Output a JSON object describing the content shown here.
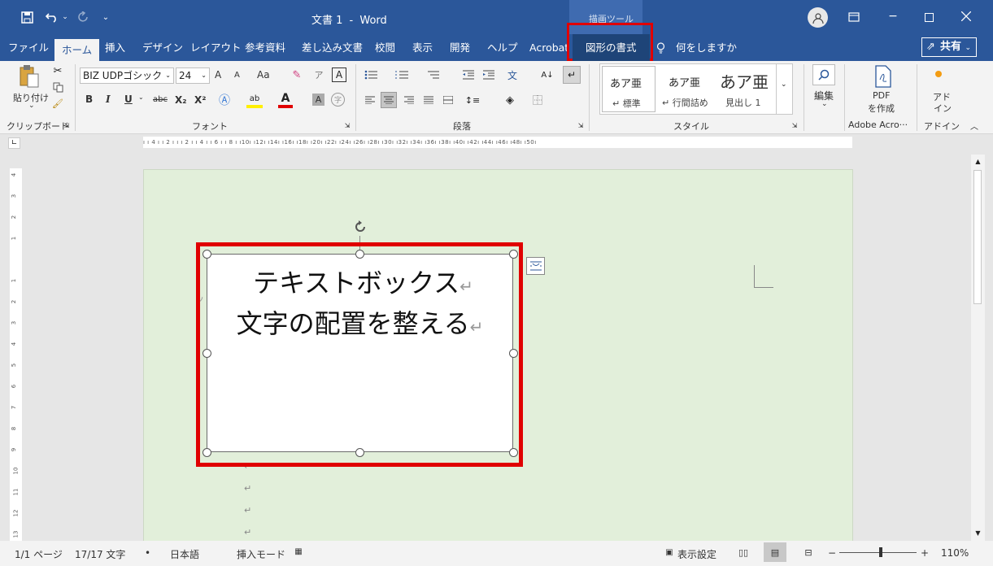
{
  "title": {
    "doc": "文書 1",
    "separator": "-",
    "app": "Word",
    "context_tab": "描画ツール",
    "qat_more": "⌄"
  },
  "tabs": [
    "ファイル",
    "ホーム",
    "挿入",
    "デザイン",
    "レイアウト",
    "参考資料",
    "差し込み文書",
    "校閲",
    "表示",
    "開発",
    "ヘルプ",
    "Acrobat",
    "図形の書式"
  ],
  "tellme": "何をしますか",
  "share": "共有",
  "ribbon": {
    "clipboard": {
      "paste": "貼り付け",
      "label": "クリップボード"
    },
    "font": {
      "name": "BIZ UDPゴシック",
      "size": "24",
      "label": "フォント",
      "bold": "B",
      "italic": "I",
      "underline": "U",
      "strike": "abc",
      "sub": "X₂",
      "sup": "X²",
      "aa": "Aa",
      "grow": "A",
      "shrink": "A"
    },
    "paragraph": {
      "label": "段落"
    },
    "styles": {
      "label": "スタイル",
      "items": [
        {
          "sample": "あア亜",
          "name": "↵ 標準"
        },
        {
          "sample": "あア亜",
          "name": "↵ 行間詰め"
        },
        {
          "sample": "あア亜",
          "name": "見出し 1"
        }
      ]
    },
    "editing": {
      "label": "編集"
    },
    "pdf": {
      "line1": "PDF",
      "line2": "を作成",
      "group": "Adobe Acro···"
    },
    "addin": {
      "line1": "アド",
      "line2": "イン",
      "group": "アドイン"
    }
  },
  "ruler": {
    "h": "ı ı 4 ı  ı 2 ı  ı    ı 2 ı  ı 4 ı  ı 6 ı  ı 8 ı  ı10ı  ı12ı  ı14ı  ı16ı  ı18ı  ı20ı  ı22ı  ı24ı  ı26ı  ı28ı  ı30ı  ı32ı  ı34ı  ı36ı  ı38ı  ı40ı  ı42ı  ı44ı  ı46ı  ı48ı  ı50ı",
    "v": [
      "4",
      "3",
      "2",
      "1",
      "",
      "1",
      "2",
      "3",
      "4",
      "5",
      "6",
      "7",
      "8",
      "9",
      "10",
      "11",
      "12",
      "13"
    ]
  },
  "textbox": {
    "line1": "テキストボックス",
    "line2": "文字の配置を整える"
  },
  "status": {
    "page": "1/1 ページ",
    "words": "17/17 文字",
    "lang": "日本語",
    "mode": "挿入モード",
    "display": "表示設定",
    "zoom": "110%",
    "zoom_minus": "−",
    "zoom_plus": "+"
  },
  "colors": {
    "accent": "#2b579a",
    "highlight": "#e00000",
    "page": "#e2efda"
  }
}
